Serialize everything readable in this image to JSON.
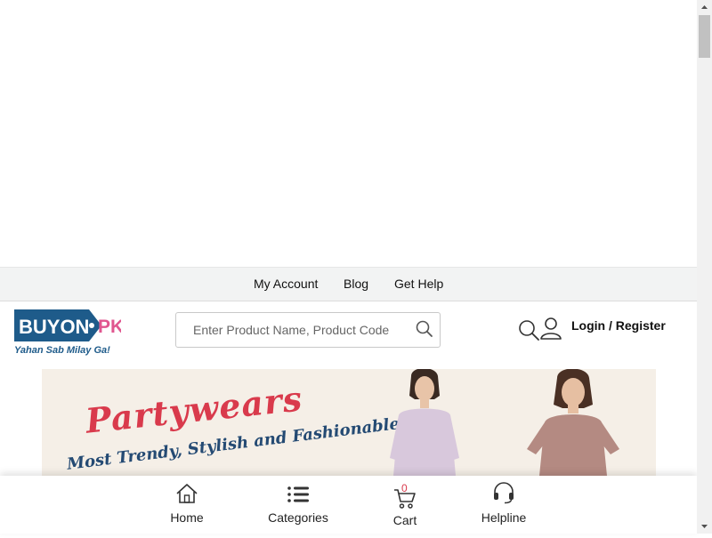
{
  "top_links": {
    "my_account": "My Account",
    "blog": "Blog",
    "get_help": "Get Help"
  },
  "logo": {
    "brand": "BUYON",
    "suffix": "PK",
    "tagline": "Yahan Sab Milay Ga!"
  },
  "search": {
    "placeholder": "Enter Product Name, Product Code"
  },
  "header": {
    "login_label": "Login / Register"
  },
  "banner": {
    "title": "Partywears",
    "subtitle": "Most Trendy, Stylish and Fashionable"
  },
  "bottom_nav": {
    "home": "Home",
    "categories": "Categories",
    "cart": "Cart",
    "cart_count": "0",
    "helpline": "Helpline"
  },
  "colors": {
    "brand_blue": "#1e5b8a",
    "brand_pink": "#e0568f",
    "accent_red": "#d93a4c"
  }
}
